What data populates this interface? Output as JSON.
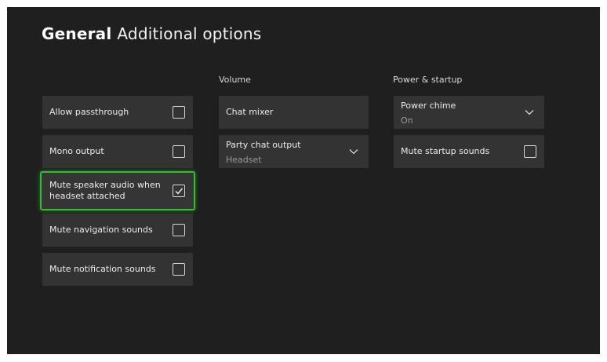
{
  "header": {
    "title_bold": "General",
    "title_rest": "Additional options"
  },
  "columns": {
    "volume_heading": "Volume",
    "power_heading": "Power & startup"
  },
  "left_options": [
    {
      "label": "Allow passthrough",
      "checked": false
    },
    {
      "label": "Mono output",
      "checked": false
    },
    {
      "label_line1": "Mute speaker audio when",
      "label_line2": "headset attached",
      "checked": true,
      "focused": true
    },
    {
      "label": "Mute navigation sounds",
      "checked": false
    },
    {
      "label": "Mute notification sounds",
      "checked": false
    }
  ],
  "volume": {
    "chat_mixer": "Chat mixer",
    "party_chat_output": {
      "label": "Party chat output",
      "value": "Headset"
    }
  },
  "power": {
    "power_chime": {
      "label": "Power chime",
      "value": "On"
    },
    "mute_startup": {
      "label": "Mute startup sounds",
      "checked": false
    }
  },
  "colors": {
    "background": "#1f1f1f",
    "tile": "#333333",
    "focus_accent": "#2fbf2f"
  },
  "icons": [
    "checkbox-icon",
    "checkmark-icon",
    "chevron-down-icon"
  ]
}
